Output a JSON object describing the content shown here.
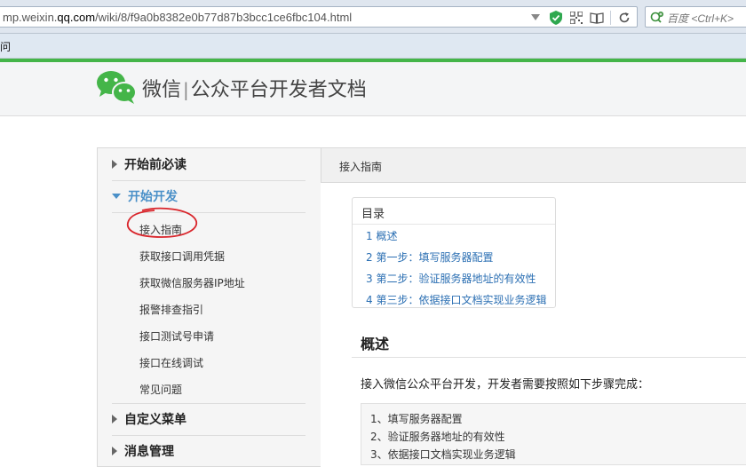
{
  "browser": {
    "url_prefix": "mp.weixin.",
    "url_domain": "qq.com",
    "url_path": "/wiki/8/f9a0b8382e0b77d87b3bcc1ce6fbc104.html",
    "search_placeholder": "百度 <Ctrl+K>",
    "bookmark_fragment": "问"
  },
  "header": {
    "brand": "微信",
    "divider": "|",
    "subtitle": "公众平台开发者文档"
  },
  "sidebar": {
    "groups": [
      {
        "label": "开始前必读",
        "expanded": false
      },
      {
        "label": "开始开发",
        "expanded": true
      },
      {
        "label": "自定义菜单",
        "expanded": false
      },
      {
        "label": "消息管理",
        "expanded": false
      }
    ],
    "items": [
      {
        "label": "接入指南"
      },
      {
        "label": "获取接口调用凭据"
      },
      {
        "label": "获取微信服务器IP地址"
      },
      {
        "label": "报警排查指引"
      },
      {
        "label": "接口测试号申请"
      },
      {
        "label": "接口在线调试"
      },
      {
        "label": "常见问题"
      }
    ]
  },
  "main": {
    "breadcrumb": "接入指南",
    "toc": {
      "title": "目录",
      "items": [
        {
          "label": "1 概述"
        },
        {
          "label": "2 第一步：填写服务器配置"
        },
        {
          "label": "3 第二步：验证服务器地址的有效性"
        },
        {
          "label": "4 第三步：依据接口文档实现业务逻辑"
        }
      ]
    },
    "section_title": "概述",
    "intro": "接入微信公众平台开发，开发者需要按照如下步骤完成：",
    "steps": [
      {
        "label": "1、填写服务器配置"
      },
      {
        "label": "2、验证服务器地址的有效性"
      },
      {
        "label": "3、依据接口文档实现业务逻辑"
      }
    ]
  },
  "colors": {
    "accent_green": "#44b549",
    "link_blue": "#2b6fb3",
    "open_group_blue": "#4a90c8",
    "annotation_red": "#d9252b"
  }
}
